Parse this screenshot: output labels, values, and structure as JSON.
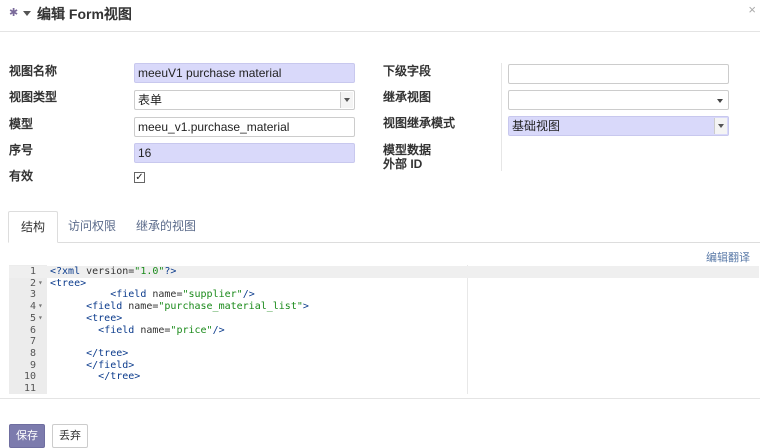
{
  "header": {
    "title": "编辑 Form视图",
    "close": "×"
  },
  "form": {
    "view_name": {
      "label": "视图名称",
      "value": "meeuV1 purchase material"
    },
    "view_type": {
      "label": "视图类型",
      "value": "表单"
    },
    "model": {
      "label": "模型",
      "value": "meeu_v1.purchase_material"
    },
    "sequence": {
      "label": "序号",
      "value": "16"
    },
    "active": {
      "label": "有效",
      "checked": true,
      "mark": "✓"
    },
    "child_field": {
      "label": "下级字段",
      "value": ""
    },
    "inherit_view": {
      "label": "继承视图",
      "value": ""
    },
    "inherit_mode": {
      "label": "视图继承模式",
      "value": "基础视图"
    },
    "model_data_line1": "模型数据",
    "model_data_line2": "外部 ID"
  },
  "tabs": [
    "结构",
    "访问权限",
    "继承的视图"
  ],
  "active_tab": "结构",
  "edit_translate": "编辑翻译",
  "editor": {
    "lines": [
      {
        "n": "1",
        "fold": "",
        "text": "<?xml version=\"1.0\"?>"
      },
      {
        "n": "2",
        "fold": "▾",
        "text": "<tree>"
      },
      {
        "n": "3",
        "fold": "",
        "text": "          <field name=\"supplier\"/>"
      },
      {
        "n": "4",
        "fold": "▾",
        "text": "      <field name=\"purchase_material_list\">"
      },
      {
        "n": "5",
        "fold": "▾",
        "text": "      <tree>"
      },
      {
        "n": "6",
        "fold": "",
        "text": "        <field name=\"price\"/>"
      },
      {
        "n": "7",
        "fold": "",
        "text": ""
      },
      {
        "n": "8",
        "fold": "",
        "text": "      </tree>"
      },
      {
        "n": "9",
        "fold": "",
        "text": "      </field>"
      },
      {
        "n": "10",
        "fold": "",
        "text": "        </tree>"
      },
      {
        "n": "11",
        "fold": "",
        "text": ""
      }
    ]
  },
  "buttons": {
    "save": "保存",
    "discard": "丢弃"
  },
  "colors": {
    "accent": "#7c7bad",
    "highlight": "#d9d9fa"
  }
}
